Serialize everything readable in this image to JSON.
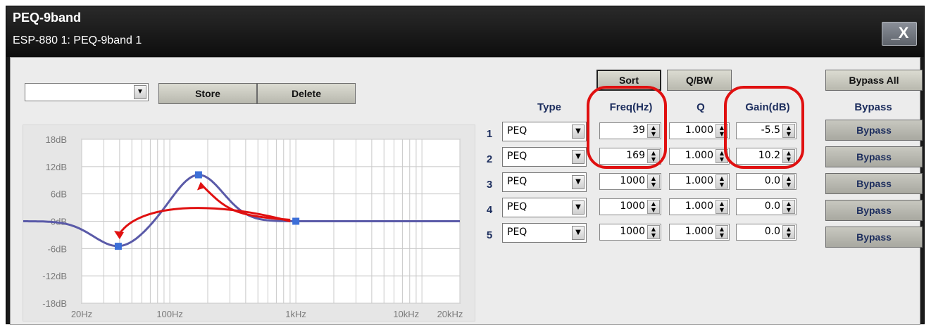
{
  "window": {
    "title": "PEQ-9band",
    "subtitle": "ESP-880 1: PEQ-9band 1",
    "controls": "_X"
  },
  "preset": {
    "selected": "",
    "store_label": "Store",
    "delete_label": "Delete"
  },
  "toolbar": {
    "sort_label": "Sort",
    "qbw_label": "Q/BW",
    "bypass_all_label": "Bypass All"
  },
  "graph": {
    "y_ticks": [
      "18dB",
      "12dB",
      "6dB",
      "0dB",
      "-6dB",
      "-12dB",
      "-18dB"
    ],
    "x_ticks": [
      "20Hz",
      "100Hz",
      "1kHz",
      "10kHz",
      "20kHz"
    ],
    "curve_color": "#5a5aa8",
    "marker_color": "#3c6fd8",
    "annotation_color": "#e01010",
    "markers": [
      {
        "freq": 39,
        "gain": -5.5
      },
      {
        "freq": 169,
        "gain": 10.2
      },
      {
        "freq": 1000,
        "gain": 0.0
      }
    ]
  },
  "bands": {
    "headers": {
      "type": "Type",
      "freq": "Freq(Hz)",
      "q": "Q",
      "gain": "Gain(dB)",
      "bypass": "Bypass"
    },
    "rows": [
      {
        "num": "1",
        "type": "PEQ",
        "freq": "39",
        "q": "1.000",
        "gain": "-5.5",
        "bypass": "Bypass"
      },
      {
        "num": "2",
        "type": "PEQ",
        "freq": "169",
        "q": "1.000",
        "gain": "10.2",
        "bypass": "Bypass"
      },
      {
        "num": "3",
        "type": "PEQ",
        "freq": "1000",
        "q": "1.000",
        "gain": "0.0",
        "bypass": "Bypass"
      },
      {
        "num": "4",
        "type": "PEQ",
        "freq": "1000",
        "q": "1.000",
        "gain": "0.0",
        "bypass": "Bypass"
      },
      {
        "num": "5",
        "type": "PEQ",
        "freq": "1000",
        "q": "1.000",
        "gain": "0.0",
        "bypass": "Bypass"
      }
    ]
  }
}
